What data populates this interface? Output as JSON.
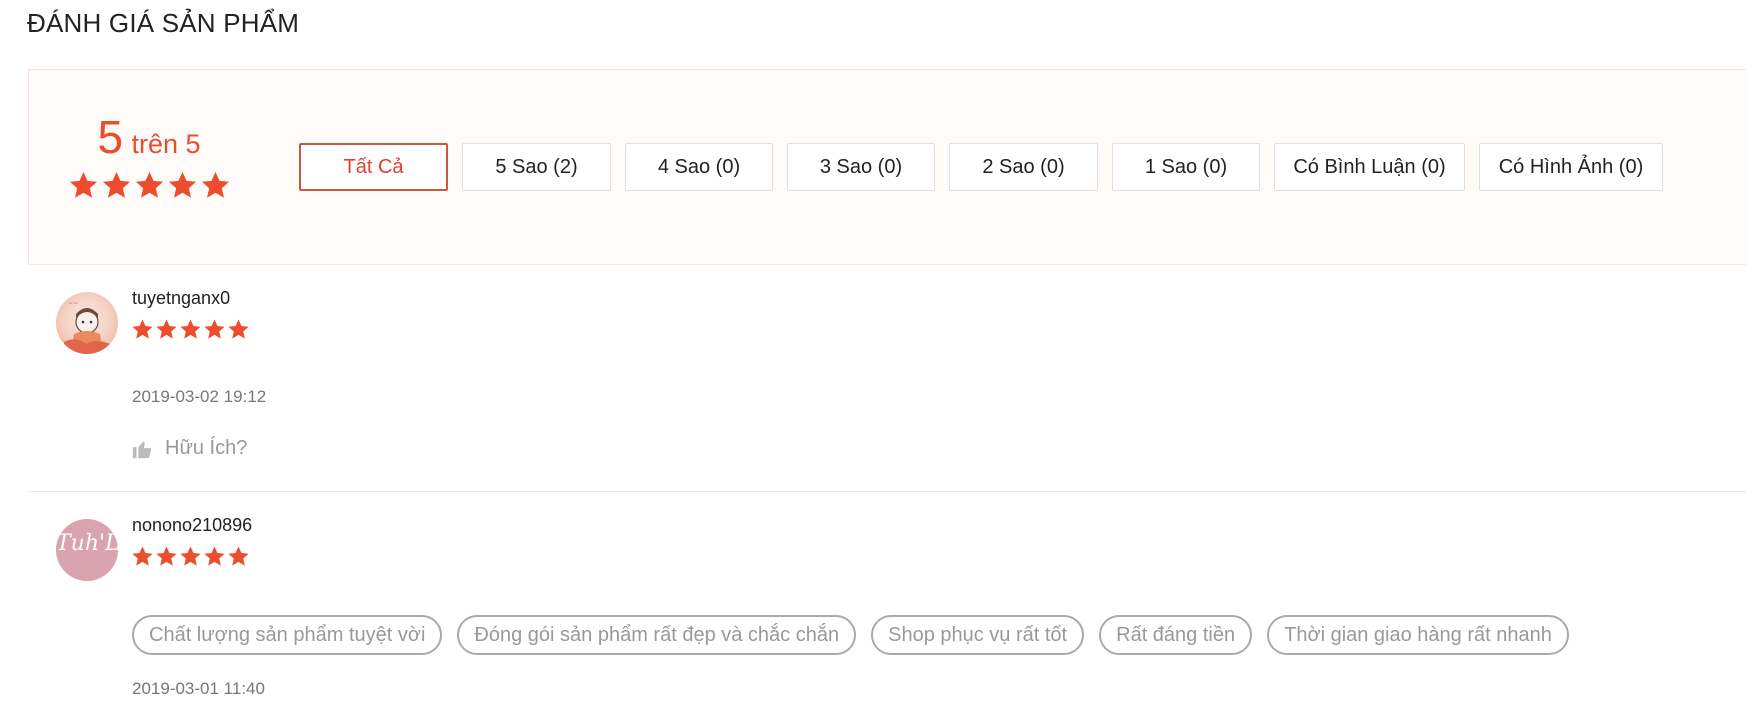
{
  "page": {
    "title": "ĐÁNH GIÁ SẢN PHẨM"
  },
  "summary": {
    "score": "5",
    "score_suffix": "trên 5",
    "stars": 5,
    "accent_color": "#ee4d2d"
  },
  "filters": [
    {
      "label": "Tất Cả",
      "active": true
    },
    {
      "label": "5 Sao (2)",
      "active": false
    },
    {
      "label": "4 Sao (0)",
      "active": false
    },
    {
      "label": "3 Sao (0)",
      "active": false
    },
    {
      "label": "2 Sao (0)",
      "active": false
    },
    {
      "label": "1 Sao (0)",
      "active": false
    },
    {
      "label": "Có Bình Luận (0)",
      "active": false
    },
    {
      "label": "Có Hình Ảnh (0)",
      "active": false
    }
  ],
  "reviews": [
    {
      "username": "tuyetnganx0",
      "stars": 5,
      "timestamp": "2019-03-02 19:12",
      "helpful_label": "Hữu Ích?",
      "avatar_icon": "avatar-illustration-icon"
    },
    {
      "username": "nonono210896",
      "stars": 5,
      "avatar_text": "Tuh'L",
      "tags": [
        "Chất lượng sản phẩm tuyệt vời",
        "Đóng gói sản phẩm rất đẹp và chắc chắn",
        "Shop phục vụ rất tốt",
        "Rất đáng tiền",
        "Thời gian giao hàng rất nhanh"
      ],
      "timestamp": "2019-03-01 11:40"
    }
  ]
}
